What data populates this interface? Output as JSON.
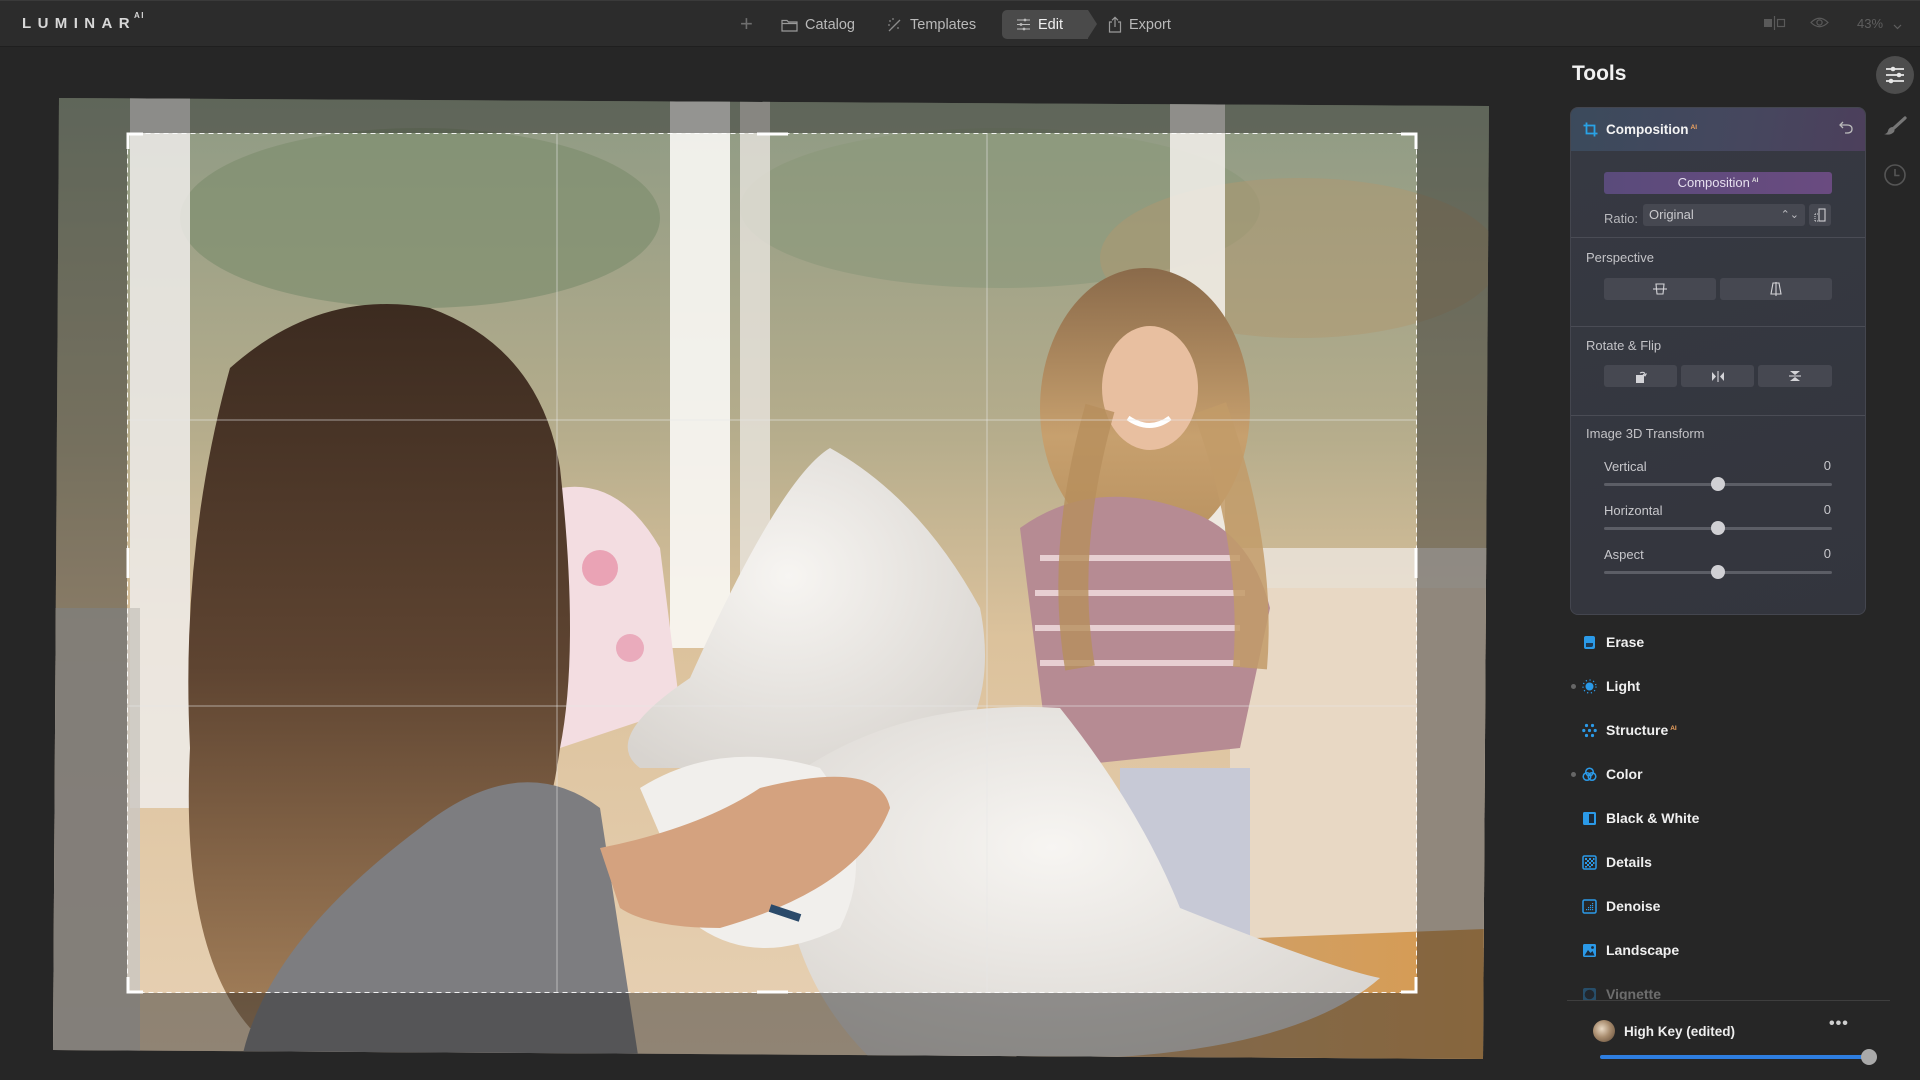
{
  "app": {
    "logo": "LUMINAR",
    "logo_suffix": "AI"
  },
  "topbar": {
    "add_label": "+",
    "nav": [
      {
        "label": "Catalog",
        "icon": "folder-icon"
      },
      {
        "label": "Templates",
        "icon": "magic-wand-icon"
      },
      {
        "label": "Edit",
        "icon": "sliders-icon",
        "active": true
      },
      {
        "label": "Export",
        "icon": "share-icon"
      }
    ],
    "zoom_level": "43%",
    "right_icons": [
      "compare-icon",
      "eye-icon",
      "chevron-down-icon"
    ]
  },
  "canvas": {
    "crop_grid": "rule-of-thirds",
    "image_description": "Two girls having a pillow fight in front of a bright window"
  },
  "panel": {
    "title": "Tools",
    "composition": {
      "title": "Composition",
      "ai_badge": "AI",
      "ai_button_label": "Composition",
      "ratio_label": "Ratio:",
      "ratio_value": "Original",
      "perspective_label": "Perspective",
      "rotate_flip_label": "Rotate & Flip",
      "transform_label": "Image 3D Transform",
      "sliders": [
        {
          "label": "Vertical",
          "value": "0",
          "position": 0.5
        },
        {
          "label": "Horizontal",
          "value": "0",
          "position": 0.5
        },
        {
          "label": "Aspect",
          "value": "0",
          "position": 0.5
        }
      ]
    },
    "tools": [
      {
        "label": "Erase",
        "icon": "erase-icon",
        "ai": false,
        "modified": false
      },
      {
        "label": "Light",
        "icon": "sun-icon",
        "ai": false,
        "modified": true
      },
      {
        "label": "Structure",
        "icon": "structure-icon",
        "ai": true,
        "modified": false
      },
      {
        "label": "Color",
        "icon": "color-circles-icon",
        "ai": false,
        "modified": true
      },
      {
        "label": "Black & White",
        "icon": "black-white-icon",
        "ai": false,
        "modified": false
      },
      {
        "label": "Details",
        "icon": "details-icon",
        "ai": false,
        "modified": false
      },
      {
        "label": "Denoise",
        "icon": "denoise-icon",
        "ai": false,
        "modified": false
      },
      {
        "label": "Landscape",
        "icon": "landscape-icon",
        "ai": false,
        "modified": false
      },
      {
        "label": "Vignette",
        "icon": "vignette-icon",
        "ai": false,
        "modified": false
      }
    ],
    "preset": {
      "name": "High Key (edited)",
      "more_label": "•••",
      "amount": 1.0
    }
  },
  "colors": {
    "accent_blue": "#2e8ae6",
    "ai_orange": "#f0a460",
    "composition_button": "#5f4b7e"
  }
}
